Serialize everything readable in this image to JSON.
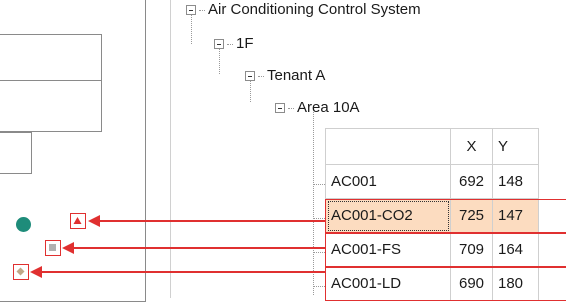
{
  "tree": {
    "root": "Air Conditioning Control System",
    "floor": "1F",
    "tenant": "Tenant A",
    "area": "Area 10A"
  },
  "grid": {
    "headers": {
      "name": "",
      "x": "X",
      "y": "Y"
    },
    "rows": [
      {
        "name": "AC001",
        "x": "692",
        "y": "148"
      },
      {
        "name": "AC001-CO2",
        "x": "725",
        "y": "147"
      },
      {
        "name": "AC001-FS",
        "x": "709",
        "y": "164"
      },
      {
        "name": "AC001-LD",
        "x": "690",
        "y": "180"
      }
    ],
    "selected_row": "AC001-CO2"
  },
  "markers": [
    {
      "target": "AC001-CO2",
      "icon": "triangle-up-icon",
      "color": "#e03030"
    },
    {
      "target": "AC001-FS",
      "icon": "square-icon",
      "color": "#b0b0b0"
    },
    {
      "target": "AC001-LD",
      "icon": "diamond-icon",
      "color": "#c0a888"
    }
  ],
  "colors": {
    "accent_red": "#e03030",
    "selection": "#fcdcc0",
    "sensor_teal": "#1e8c7a"
  }
}
